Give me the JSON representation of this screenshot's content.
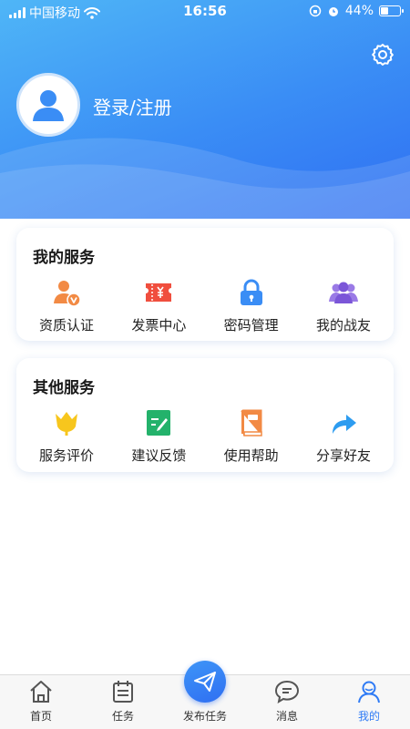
{
  "status_bar": {
    "carrier": "中国移动",
    "time": "16:56",
    "battery": "44%",
    "battery_level": 0.44
  },
  "profile": {
    "login_label": "登录/注册"
  },
  "my_services": {
    "title": "我的服务",
    "items": [
      {
        "label": "资质认证",
        "icon": "certification-icon",
        "color": "#f28a44"
      },
      {
        "label": "发票中心",
        "icon": "invoice-icon",
        "color": "#f04e3e"
      },
      {
        "label": "密码管理",
        "icon": "lock-icon",
        "color": "#3a8df5"
      },
      {
        "label": "我的战友",
        "icon": "team-icon",
        "color": "#7b56d8"
      }
    ]
  },
  "other_services": {
    "title": "其他服务",
    "items": [
      {
        "label": "服务评价",
        "icon": "tulip-icon",
        "color": "#f7c61d"
      },
      {
        "label": "建议反馈",
        "icon": "feedback-icon",
        "color": "#23b26b"
      },
      {
        "label": "使用帮助",
        "icon": "help-book-icon",
        "color": "#f28a44"
      },
      {
        "label": "分享好友",
        "icon": "share-icon",
        "color": "#2d9cf0"
      }
    ]
  },
  "tabbar": {
    "tabs": [
      {
        "label": "首页",
        "icon": "home-icon"
      },
      {
        "label": "任务",
        "icon": "task-icon"
      },
      {
        "label": "发布任务",
        "icon": "send-icon"
      },
      {
        "label": "消息",
        "icon": "message-icon"
      },
      {
        "label": "我的",
        "icon": "profile-icon",
        "active": true
      }
    ]
  },
  "colors": {
    "accent": "#2f7bf5",
    "header_start": "#4fb6f7",
    "header_end": "#2f6ff2"
  }
}
